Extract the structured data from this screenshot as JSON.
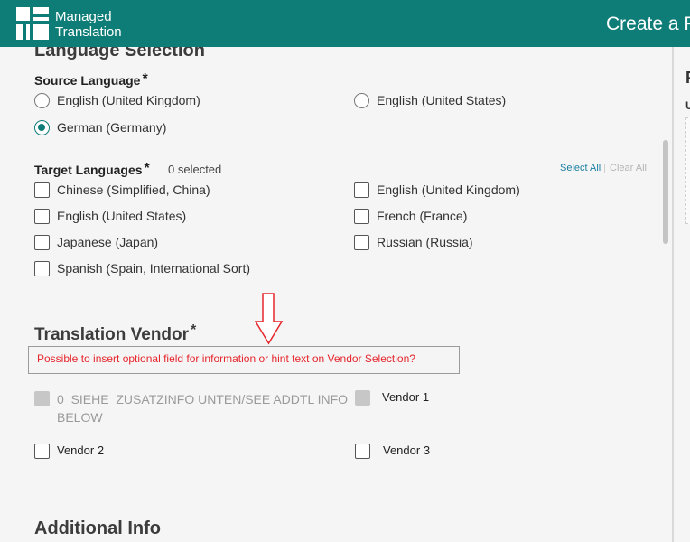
{
  "header": {
    "brand_line1": "Managed",
    "brand_line2": "Translation",
    "page_title": "Create a P"
  },
  "language_selection": {
    "title": "Language Selection",
    "source": {
      "label": "Source Language",
      "required_mark": "*",
      "options": [
        {
          "label": "English (United Kingdom)",
          "selected": false
        },
        {
          "label": "English (United States)",
          "selected": false
        },
        {
          "label": "German (Germany)",
          "selected": true
        }
      ]
    },
    "target": {
      "label": "Target Languages",
      "required_mark": "*",
      "count_text": "0 selected",
      "select_all": "Select All",
      "clear_all": "Clear All",
      "options": [
        {
          "label": "Chinese (Simplified, China)",
          "checked": false
        },
        {
          "label": "English (United Kingdom)",
          "checked": false
        },
        {
          "label": "English (United States)",
          "checked": false
        },
        {
          "label": "French (France)",
          "checked": false
        },
        {
          "label": "Japanese (Japan)",
          "checked": false
        },
        {
          "label": "Russian (Russia)",
          "checked": false
        },
        {
          "label": "Spanish (Spain, International Sort)",
          "checked": false
        }
      ]
    }
  },
  "vendor": {
    "title": "Translation Vendor",
    "required_mark": "*",
    "annotation": "Possible to insert optional field for information or hint text on Vendor Selection?",
    "options": [
      {
        "label_line1": "0_SIEHE_ZUSATZINFO UNTEN/SEE ADDTL INFO",
        "label_line2": "BELOW",
        "disabled": true
      },
      {
        "label": "Vendor 1",
        "disabled": true
      },
      {
        "label": "Vendor 2",
        "disabled": false
      },
      {
        "label": "Vendor 3",
        "disabled": false
      }
    ]
  },
  "additional_info": {
    "title": "Additional Info"
  },
  "right_panel": {
    "letter1": "F",
    "letter2": "U"
  },
  "colors": {
    "brand": "#0e7d77",
    "link": "#1a7fa3",
    "annotation": "#e5262d"
  }
}
